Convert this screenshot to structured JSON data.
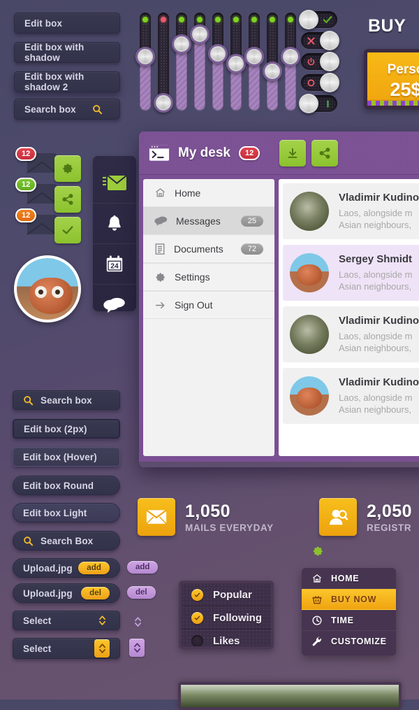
{
  "left_fields_top": [
    {
      "label": "Edit box",
      "icon": null
    },
    {
      "label": "Edit box with shadow",
      "icon": null
    },
    {
      "label": "Edit box with shadow 2",
      "icon": null
    },
    {
      "label": "Search box",
      "icon": "search-icon"
    }
  ],
  "left_fields_bottom": [
    {
      "label": "Search box",
      "icon": "search-icon"
    },
    {
      "label": "Edit box (2px)",
      "icon": null
    },
    {
      "label": "Edit box (Hover)",
      "icon": null
    },
    {
      "label": "Edit box Round",
      "icon": null
    },
    {
      "label": "Edit box Light",
      "icon": null
    },
    {
      "label": "Search Box",
      "icon": "search-icon"
    }
  ],
  "upload_rows": [
    {
      "label": "Upload.jpg",
      "action": "add",
      "side_action": "add"
    },
    {
      "label": "Upload.jpg",
      "action": "del",
      "side_action": "del"
    }
  ],
  "select_rows": [
    {
      "label": "Select",
      "stepper": "plain"
    },
    {
      "label": "Select",
      "stepper": "gold"
    }
  ],
  "sliders": {
    "values": [
      55,
      92,
      32,
      22,
      42,
      52,
      45,
      60,
      45
    ],
    "dot_colors": [
      "#7ed321",
      "#e8596a",
      "#7ed321",
      "#7ed321",
      "#7ed321",
      "#7ed321",
      "#7ed321",
      "#7ed321",
      "#7ed321"
    ]
  },
  "toggles": [
    {
      "icon": "check-icon",
      "state": "on",
      "icon_color": "#5aa72a"
    },
    {
      "icon": "close-icon",
      "state": "off",
      "icon_color": "#e8596a"
    },
    {
      "icon": "power-icon",
      "state": "off",
      "icon_color": "#e8596a"
    },
    {
      "icon": "circle-icon",
      "state": "off",
      "icon_color": "#e8596a"
    },
    {
      "icon": "bar-icon",
      "state": "on",
      "icon_color": "#4caf50"
    }
  ],
  "buy": {
    "title": "BUY",
    "plan": "Perso",
    "price": "25$"
  },
  "mail_badges": [
    {
      "count": "12",
      "color": "red"
    },
    {
      "count": "12",
      "color": "green"
    },
    {
      "count": "12",
      "color": "orange"
    }
  ],
  "green_buttons": [
    "gear-icon",
    "share-icon",
    "check-icon"
  ],
  "icon_bar": [
    "mail-icon",
    "bell-icon",
    "calendar-icon",
    "chat-icon"
  ],
  "calendar_day": "24",
  "desk": {
    "icon": "terminal-icon",
    "title": "My desk",
    "badge": "12",
    "actions": [
      "download-icon",
      "share-icon"
    ],
    "menu": [
      {
        "label": "Home",
        "icon": "home-icon",
        "count": null,
        "active": false
      },
      {
        "label": "Messages",
        "icon": "chat-icon",
        "count": "25",
        "active": true
      },
      {
        "label": "Documents",
        "icon": "document-icon",
        "count": "72",
        "active": false
      },
      {
        "label": "Settings",
        "icon": "gear-icon",
        "count": null,
        "active": false
      },
      {
        "label": "Sign Out",
        "icon": "arrow-right-icon",
        "count": null,
        "active": false
      }
    ],
    "messages": [
      {
        "name": "Vladimir Kudinov",
        "line1": "Laos, alongside m",
        "line2": "Asian neighbours,",
        "highlight": false,
        "avatar": "a1"
      },
      {
        "name": "Sergey Shmidt",
        "line1": "Laos, alongside m",
        "line2": "Asian neighbours,",
        "highlight": true,
        "avatar": "a2"
      },
      {
        "name": "Vladimir Kudinov",
        "line1": "Laos, alongside m",
        "line2": "Asian neighbours,",
        "highlight": false,
        "avatar": "a1"
      },
      {
        "name": "Vladimir Kudinov",
        "line1": "Laos, alongside m",
        "line2": "Asian neighbours,",
        "highlight": false,
        "avatar": "a2"
      }
    ]
  },
  "stats": [
    {
      "number": "1,050",
      "caption": "MAILS EVERYDAY",
      "icon": "mail-icon"
    },
    {
      "number": "2,050",
      "caption": "REGISTR",
      "icon": "user-search-icon"
    }
  ],
  "checkboxes": [
    {
      "label": "Popular",
      "checked": true
    },
    {
      "label": "Following",
      "checked": true
    },
    {
      "label": "Likes",
      "checked": false
    }
  ],
  "dropdown": {
    "trigger_icon": "gear-icon",
    "items": [
      {
        "label": "HOME",
        "icon": "home-icon",
        "selected": false
      },
      {
        "label": "BUY NOW",
        "icon": "cart-icon",
        "selected": true
      },
      {
        "label": "TIME",
        "icon": "clock-icon",
        "selected": false
      },
      {
        "label": "CUSTOMIZE",
        "icon": "wrench-icon",
        "selected": false
      }
    ]
  },
  "colors": {
    "accent_gold": "#f0a50f",
    "accent_green": "#8cc22e",
    "panel_purple": "#7a4f93",
    "badge_red": "#c62f3c"
  }
}
